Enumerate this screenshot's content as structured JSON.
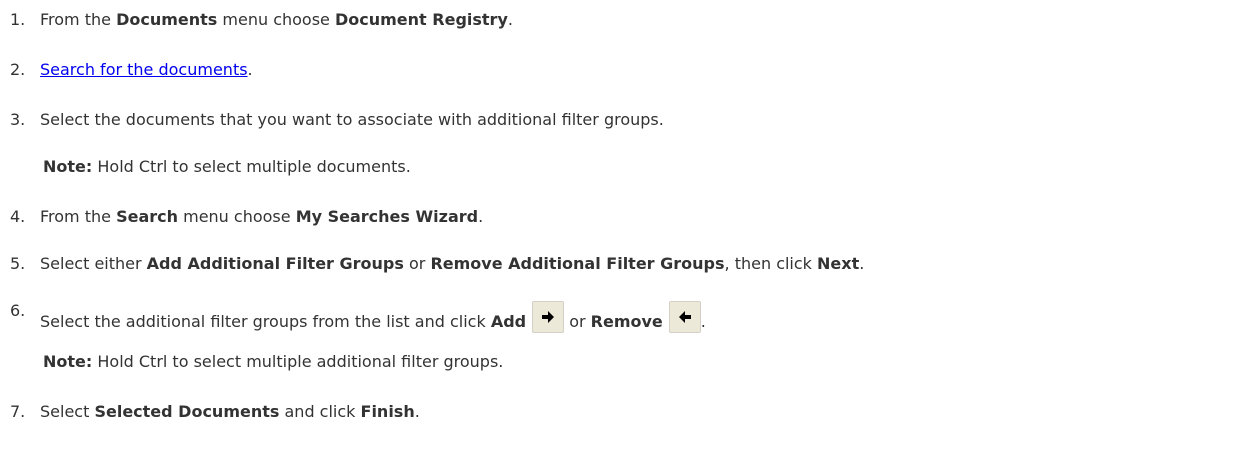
{
  "steps": [
    {
      "num": "1.",
      "parts": [
        "From the ",
        "Documents",
        " menu choose ",
        "Document Registry",
        "."
      ]
    },
    {
      "num": "2.",
      "link": "Search for the documents",
      "after": "."
    },
    {
      "num": "3.",
      "text": "Select the documents that you want to associate with additional filter groups."
    },
    {
      "num": "4.",
      "parts": [
        "From the ",
        "Search",
        " menu choose ",
        "My Searches Wizard",
        "."
      ]
    },
    {
      "num": "5.",
      "parts": [
        "Select either ",
        "Add Additional Filter Groups",
        " or ",
        "Remove Additional Filter Groups",
        ", then click ",
        "Next",
        "."
      ]
    },
    {
      "num": "6.",
      "parts": [
        "Select the additional filter groups from the list and click ",
        "Add",
        " or ",
        "Remove",
        "."
      ]
    },
    {
      "num": "7.",
      "parts": [
        "Select ",
        "Selected Documents",
        " and click ",
        "Finish",
        "."
      ]
    }
  ],
  "notes": {
    "note1_label": "Note:",
    "note1_text": " Hold Ctrl to select multiple documents.",
    "note2_label": "Note:",
    "note2_text": " Hold Ctrl to select multiple additional filter groups."
  },
  "icons": {
    "add": "arrow-right-icon",
    "remove": "arrow-left-icon",
    "button_bg": "#ece9d8"
  }
}
